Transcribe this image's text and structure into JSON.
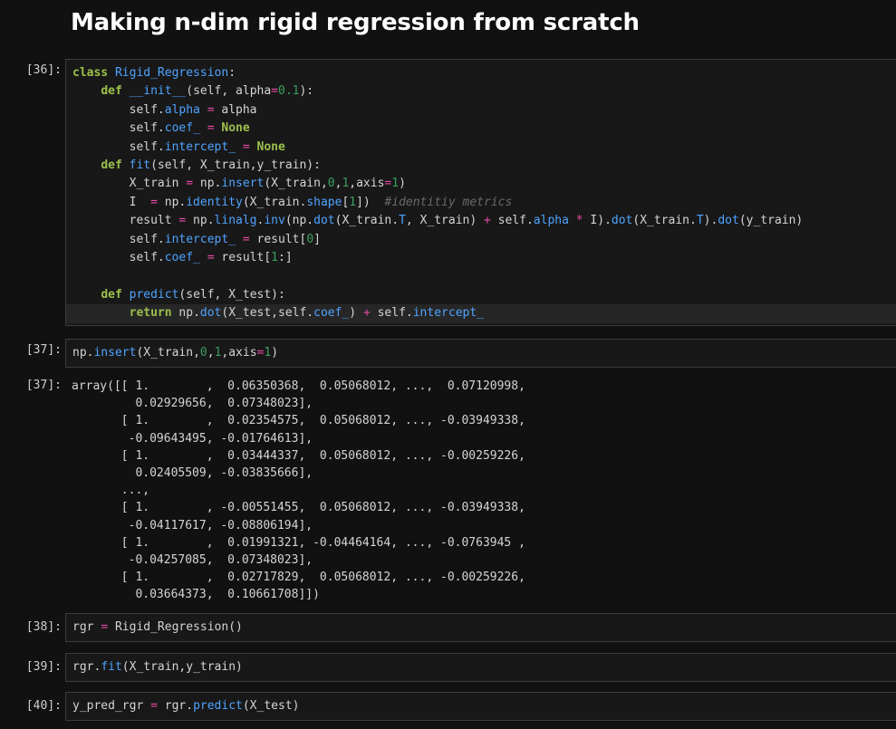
{
  "heading": "Making n-dim rigid regression from scratch",
  "cells": [
    {
      "prompt": "[36]:",
      "type": "code",
      "lines": [
        "class Rigid_Regression:",
        "    def __init__(self, alpha=0.1):",
        "        self.alpha = alpha",
        "        self.coef_ = None",
        "        self.intercept_ = None",
        "    def fit(self, X_train,y_train):",
        "        X_train = np.insert(X_train,0,1,axis=1)",
        "        I  = np.identity(X_train.shape[1])  #identitiy metrics",
        "        result = np.linalg.inv(np.dot(X_train.T, X_train) + self.alpha * I).dot(X_train.T).dot(y_train)",
        "        self.intercept_ = result[0]",
        "        self.coef_ = result[1:]",
        "",
        "    def predict(self, X_test):",
        "        return np.dot(X_test,self.coef_) + self.intercept_"
      ]
    },
    {
      "prompt": "[37]:",
      "type": "code",
      "lines": [
        "np.insert(X_train,0,1,axis=1)"
      ]
    },
    {
      "prompt": "[37]:",
      "type": "output",
      "lines": [
        "array([[ 1.        ,  0.06350368,  0.05068012, ...,  0.07120998,",
        "         0.02929656,  0.07348023],",
        "       [ 1.        ,  0.02354575,  0.05068012, ..., -0.03949338,",
        "        -0.09643495, -0.01764613],",
        "       [ 1.        ,  0.03444337,  0.05068012, ..., -0.00259226,",
        "         0.02405509, -0.03835666],",
        "       ...,",
        "       [ 1.        , -0.00551455,  0.05068012, ..., -0.03949338,",
        "        -0.04117617, -0.08806194],",
        "       [ 1.        ,  0.01991321, -0.04464164, ..., -0.0763945 ,",
        "        -0.04257085,  0.07348023],",
        "       [ 1.        ,  0.02717829,  0.05068012, ..., -0.00259226,",
        "         0.03664373,  0.10661708]])"
      ]
    },
    {
      "prompt": "[38]:",
      "type": "code",
      "lines": [
        "rgr = Rigid_Regression()"
      ]
    },
    {
      "prompt": "[39]:",
      "type": "code",
      "lines": [
        "rgr.fit(X_train,y_train)"
      ]
    },
    {
      "prompt": "[40]:",
      "type": "code",
      "lines": [
        "y_pred_rgr = rgr.predict(X_test)"
      ]
    }
  ]
}
